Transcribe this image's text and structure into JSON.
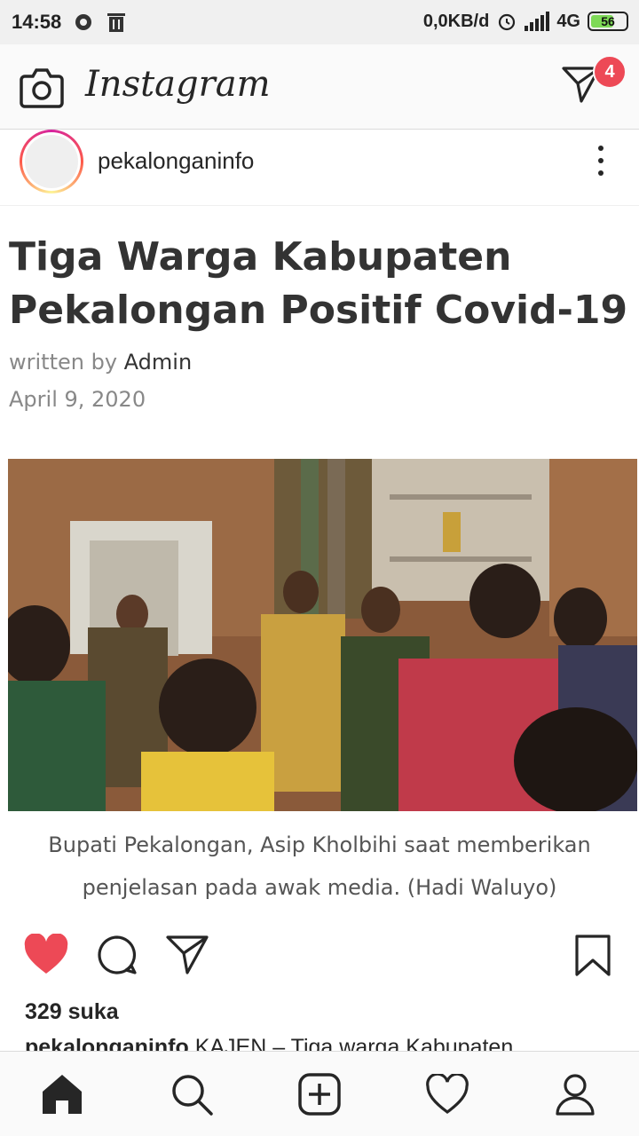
{
  "status_bar": {
    "time": "14:58",
    "data_speed": "0,0KB/d",
    "network": "4G",
    "battery": "56"
  },
  "header": {
    "logo": "Instagram",
    "dm_badge": "4"
  },
  "post": {
    "username": "pekalonganinfo",
    "article": {
      "title": "Tiga Warga Kabupaten Pekalongan Positif Covid-19",
      "written_by_label": "written by",
      "author": "Admin",
      "date": "April 9, 2020",
      "photo_caption": "Bupati Pekalongan, Asip Kholbihi saat memberikan penjelasan pada awak media. (Hadi Waluyo)"
    },
    "likes": "329 suka",
    "caption_user": "pekalonganinfo",
    "caption_text": "KAJEN – Tiga warga Kabupaten"
  },
  "colors": {
    "like_red": "#ed4956",
    "badge_red": "#ed4956",
    "text": "#262626"
  },
  "icons": {
    "camera": "camera-icon",
    "direct": "direct-message-icon",
    "more": "more-options-icon",
    "like": "heart-filled-icon",
    "comment": "comment-icon",
    "share": "share-icon",
    "save": "bookmark-icon",
    "home": "home-icon",
    "search": "search-icon",
    "add": "add-post-icon",
    "activity": "heart-outline-icon",
    "profile": "profile-icon"
  }
}
